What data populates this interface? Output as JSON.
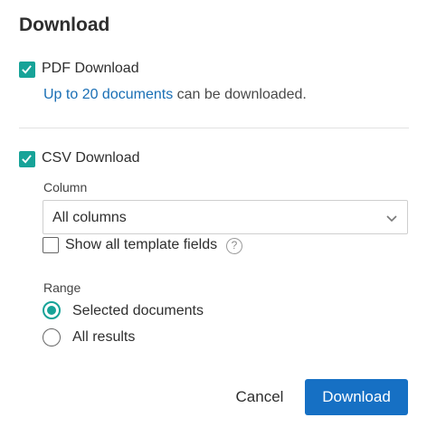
{
  "dialog": {
    "title": "Download",
    "pdf": {
      "checked": true,
      "label": "PDF Download",
      "info_link": "Up to 20 documents",
      "info_rest": " can be downloaded."
    },
    "csv": {
      "checked": true,
      "label": "CSV Download",
      "column_label": "Column",
      "column_value": "All columns",
      "show_template_label": "Show all template fields",
      "show_template_checked": false,
      "help_glyph": "?",
      "range_label": "Range",
      "range_options": [
        {
          "label": "Selected documents",
          "selected": true
        },
        {
          "label": "All results",
          "selected": false
        }
      ]
    },
    "buttons": {
      "cancel": "Cancel",
      "download": "Download"
    },
    "colors": {
      "accent": "#17a398",
      "primary": "#1670c4",
      "link": "#1a6fb5"
    }
  }
}
